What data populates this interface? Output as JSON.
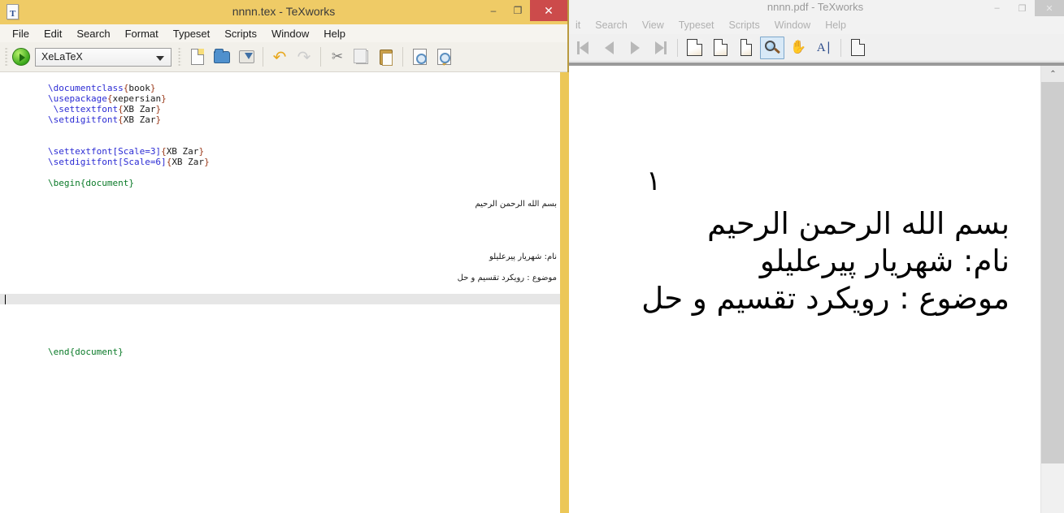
{
  "pdf_window": {
    "title": "nnnn.pdf - TeXworks",
    "window_controls": {
      "minimize": "‒",
      "maximize": "❐",
      "close": "✕"
    },
    "menus": [
      "it",
      "Search",
      "View",
      "Typeset",
      "Scripts",
      "Window",
      "Help"
    ],
    "toolbar": [
      {
        "name": "first-page-icon",
        "label": "First Page"
      },
      {
        "name": "previous-page-icon",
        "label": "Previous Page"
      },
      {
        "name": "next-page-icon",
        "label": "Next Page"
      },
      {
        "name": "last-page-icon",
        "label": "Last Page"
      },
      {
        "name": "fit-page-icon",
        "label": "Fit to Window"
      },
      {
        "name": "fit-width-icon",
        "label": "Fit to Width"
      },
      {
        "name": "actual-size-icon",
        "label": "Actual Size"
      },
      {
        "name": "magnify-tool-icon",
        "label": "Magnify"
      },
      {
        "name": "pan-tool-icon",
        "label": "Pan"
      },
      {
        "name": "text-select-tool-icon",
        "label": "Select Text"
      },
      {
        "name": "source-view-icon",
        "label": "Go to Source"
      }
    ],
    "active_tool": "magnify-tool-icon",
    "page": {
      "page_number": "۱",
      "lines": [
        "بسم الله الرحمن الرحيم",
        "نام: شهریار پیرعلیلو",
        "موضوع : رویکرد تقسیم و حل"
      ]
    },
    "scrollbar": {
      "up_arrow": "⌃"
    }
  },
  "editor_window": {
    "title": "nnnn.tex - TeXworks",
    "app_icon": "texworks-document-icon",
    "window_controls": {
      "minimize": "‒",
      "maximize": "❐",
      "close": "✕"
    },
    "menus": [
      "File",
      "Edit",
      "Search",
      "Format",
      "Typeset",
      "Scripts",
      "Window",
      "Help"
    ],
    "toolbar": {
      "run_button": "typeset-run-button",
      "engine_selected": "XeLaTeX",
      "engine_options": [
        "XeLaTeX"
      ],
      "buttons": [
        {
          "name": "new-file-icon",
          "label": "New"
        },
        {
          "name": "open-file-icon",
          "label": "Open"
        },
        {
          "name": "save-file-icon",
          "label": "Save"
        },
        {
          "name": "undo-icon",
          "label": "Undo"
        },
        {
          "name": "redo-icon",
          "label": "Redo"
        },
        {
          "name": "cut-icon",
          "label": "Cut"
        },
        {
          "name": "copy-icon",
          "label": "Copy"
        },
        {
          "name": "paste-icon",
          "label": "Paste"
        },
        {
          "name": "find-icon",
          "label": "Find"
        },
        {
          "name": "find-again-icon",
          "label": "Find Again"
        }
      ]
    },
    "source": {
      "lines": [
        {
          "type": "code",
          "cmd": "\\documentclass",
          "brace_open": "{",
          "arg": "book",
          "brace_close": "}"
        },
        {
          "type": "code",
          "cmd": "\\usepackage",
          "brace_open": "{",
          "arg": "xepersian",
          "brace_close": "}"
        },
        {
          "type": "code",
          "cmd": " \\settextfont",
          "brace_open": "{",
          "arg": "XB Zar",
          "brace_close": "}"
        },
        {
          "type": "code",
          "cmd": "\\setdigitfont",
          "brace_open": "{",
          "arg": "XB Zar",
          "brace_close": "}"
        },
        {
          "type": "blank",
          "text": ""
        },
        {
          "type": "blank",
          "text": ""
        },
        {
          "type": "code",
          "cmd": "\\settextfont[Scale=3]",
          "brace_open": "{",
          "arg": "XB Zar",
          "brace_close": "}"
        },
        {
          "type": "code",
          "cmd": "\\setdigitfont[Scale=6]",
          "brace_open": "{",
          "arg": "XB Zar",
          "brace_close": "}"
        },
        {
          "type": "blank",
          "text": ""
        },
        {
          "type": "env",
          "text": "\\begin{document}"
        },
        {
          "type": "blank",
          "text": ""
        },
        {
          "type": "blank",
          "text": ""
        },
        {
          "type": "rtl",
          "text": "بسم الله الرحمن الرحيم"
        },
        {
          "type": "blank",
          "text": ""
        },
        {
          "type": "blank",
          "text": ""
        },
        {
          "type": "blank",
          "text": ""
        },
        {
          "type": "rtl",
          "text": "نام: شهریار پیرعلیلو"
        },
        {
          "type": "blank",
          "text": ""
        },
        {
          "type": "rtl",
          "text": "موضوع : رویکرد تقسیم و حل"
        },
        {
          "type": "blank",
          "text": ""
        },
        {
          "type": "blank",
          "text": ""
        },
        {
          "type": "env",
          "text": "\\end{document}"
        }
      ]
    }
  },
  "colors": {
    "editor_titlebar": "#efcb66",
    "editor_close_button": "#cc4b4b",
    "active_tool_highlight": "#d8e9f7",
    "current_line_highlight": "#e6e6e6",
    "latex_command": "#2b2bd4",
    "latex_brace": "#9b3a1a",
    "latex_environment": "#0a7a28"
  }
}
